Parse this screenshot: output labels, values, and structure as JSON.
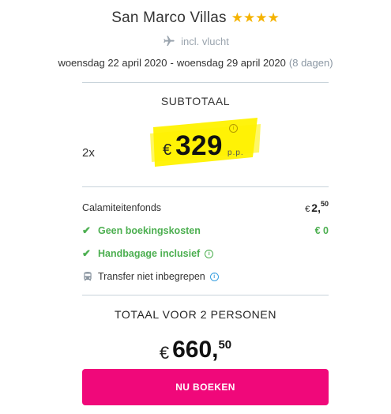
{
  "hotel": {
    "name": "San Marco Villas",
    "stars": "★★★★"
  },
  "flight": {
    "label": "incl. vlucht"
  },
  "dates": {
    "start": "woensdag 22 april 2020",
    "separator": "-",
    "end": "woensdag 29 april 2020",
    "duration": "(8 dagen)"
  },
  "subtotal": {
    "label": "SUBTOTAAL",
    "quantity": "2x",
    "currency": "€",
    "amount": "329",
    "unit": "p.p.",
    "info_symbol": "i"
  },
  "costs": [
    {
      "label": "Calamiteitenfonds",
      "currency": "€",
      "whole": "2,",
      "cents": "50"
    },
    {
      "label": "Geen boekingskosten",
      "value": "€ 0"
    },
    {
      "label": "Handbagage inclusief",
      "info_symbol": "i"
    },
    {
      "label": "Transfer niet inbegrepen",
      "info_symbol": "i"
    }
  ],
  "total": {
    "label": "TOTAAL VOOR 2 PERSONEN",
    "currency": "€",
    "whole": "660,",
    "cents": "50"
  },
  "actions": {
    "book_label": "NU BOEKEN"
  },
  "colors": {
    "accent": "#f0087a",
    "green": "#4caf50",
    "star": "#f5b301",
    "highlight": "#fff200"
  }
}
